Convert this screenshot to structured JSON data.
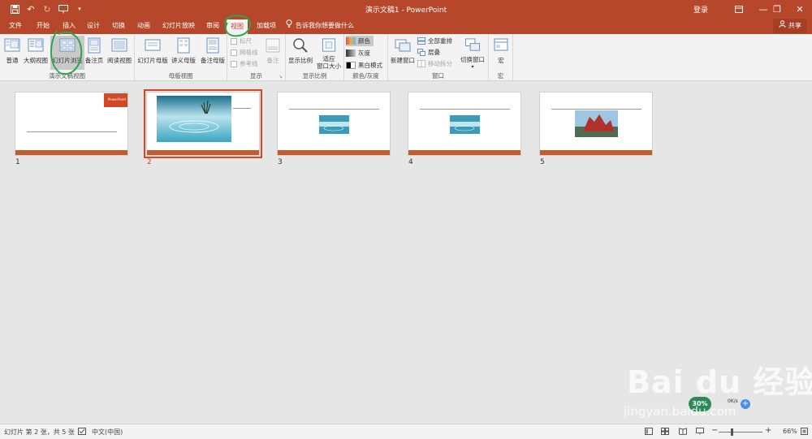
{
  "titlebar": {
    "title": "演示文稿1 - PowerPoint",
    "signin": "登录",
    "qat": [
      "save-icon",
      "undo-icon",
      "redo-icon",
      "start-from-beginning-icon",
      "customize-qat-icon"
    ],
    "window_controls": [
      "ribbon-display-icon",
      "minimize-icon",
      "restore-icon",
      "close-icon"
    ]
  },
  "tabs": [
    {
      "label": "文件"
    },
    {
      "label": "开始"
    },
    {
      "label": "插入"
    },
    {
      "label": "设计"
    },
    {
      "label": "切换"
    },
    {
      "label": "动画"
    },
    {
      "label": "幻灯片放映"
    },
    {
      "label": "审阅"
    },
    {
      "label": "视图",
      "active": true
    },
    {
      "label": "加载项"
    }
  ],
  "tellme": "告诉我你想要做什么",
  "share": "共享",
  "ribbon": {
    "groups": {
      "presentation_views": {
        "label": "演示文稿视图",
        "buttons": [
          "普通",
          "大纲视图",
          "幻灯片浏览",
          "备注页",
          "阅读视图"
        ]
      },
      "master_views": {
        "label": "母版视图",
        "buttons": [
          "幻灯片母版",
          "讲义母版",
          "备注母版"
        ]
      },
      "show": {
        "label": "显示",
        "checks": [
          "标尺",
          "网格线",
          "参考线"
        ],
        "notes": "备注"
      },
      "zoom": {
        "label": "显示比例",
        "buttons": [
          "显示比例",
          "适应",
          "窗口大小"
        ]
      },
      "color": {
        "label": "颜色/灰度",
        "options": [
          "颜色",
          "灰度",
          "黑白模式"
        ]
      },
      "window": {
        "label": "窗口",
        "new_window": "新建窗口",
        "arrange_all": "全部重排",
        "cascade": "层叠",
        "move_split": "移动拆分",
        "switch_windows": "切换窗口"
      },
      "macros": {
        "label": "宏",
        "button": "宏"
      }
    }
  },
  "slides": [
    {
      "number": "1",
      "logo": "PowerPoint"
    },
    {
      "number": "2"
    },
    {
      "number": "3"
    },
    {
      "number": "4"
    },
    {
      "number": "5"
    }
  ],
  "status": {
    "slide_info": "幻灯片 第 2 张，共 5 张",
    "language": "中文(中国)",
    "zoom": "66%",
    "zoom_level_percent": 66
  },
  "overlay": {
    "cpu_badge": "30%",
    "net_rate": "0K/s",
    "watermark_brand": "Bai du 经验",
    "watermark_url": "jingyan.baidu.com"
  },
  "colors": {
    "accent": "#b7472a",
    "selection": "#d24726",
    "annotation": "#2ea44f"
  }
}
